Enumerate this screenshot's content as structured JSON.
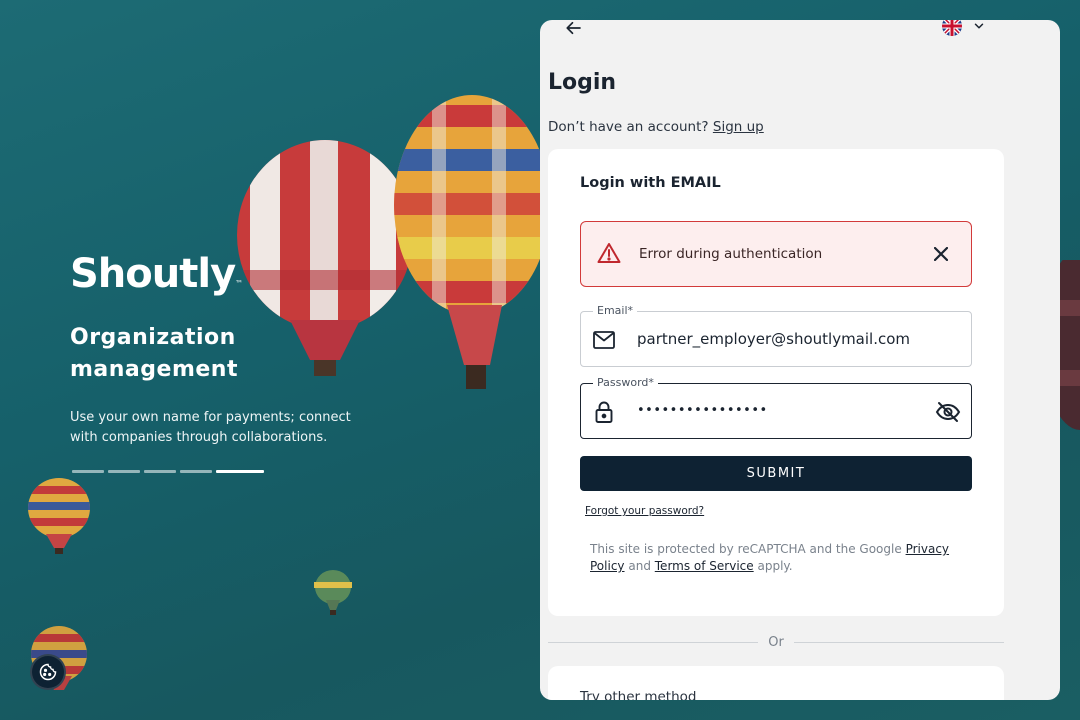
{
  "brand": {
    "logo_text": "Shoutly",
    "tm": "™"
  },
  "hero": {
    "title": "Organization management",
    "description": "Use your own name for payments; connect with companies through collaborations.",
    "slides_total": 5,
    "active_slide": 5
  },
  "topbar": {
    "back_icon": "arrow-left-icon",
    "language_flag": "uk-flag-icon",
    "language_chevron": "chevron-down-icon"
  },
  "login": {
    "title": "Login",
    "no_account_text": "Don’t have an account?",
    "signup_link": "Sign up",
    "card_title": "Login with EMAIL",
    "alert": {
      "text": "Error during authentication",
      "icon": "warning-triangle-icon",
      "close_icon": "close-icon"
    },
    "email": {
      "label": "Email",
      "required_mark": "*",
      "value": "partner_employer@shoutlymail.com",
      "icon": "mail-icon"
    },
    "password": {
      "label": "Password",
      "required_mark": "*",
      "value": "••••••••••••••••",
      "icon": "lock-icon",
      "toggle_icon": "eye-off-icon"
    },
    "submit_label": "SUBMIT",
    "forgot_password": "Forgot your password?",
    "recaptcha": {
      "prefix": "This site is protected by reCAPTCHA and the Google",
      "privacy": "Privacy Policy",
      "and": "and",
      "terms": "Terms of Service",
      "suffix": "apply."
    },
    "divider_text": "Or",
    "other_method_title": "Try other method"
  },
  "cookie_button": {
    "icon": "cookie-icon"
  },
  "colors": {
    "primary": "#0e2233",
    "error": "#d23a3a",
    "error_bg": "#fdeeee",
    "panel_bg": "#f2f2f2",
    "background": "#17626b"
  }
}
